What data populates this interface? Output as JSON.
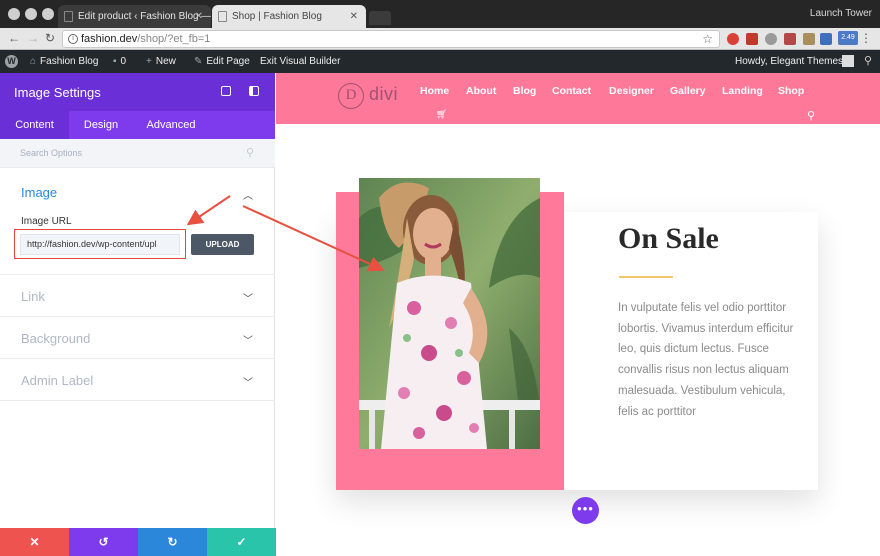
{
  "browser": {
    "tabs": [
      {
        "title": "Edit product ‹ Fashion Blog —"
      },
      {
        "title": "Shop | Fashion Blog"
      }
    ],
    "profile_name": "Launch Tower",
    "url": {
      "host": "fashion.dev",
      "path": "/shop/?et_fb=1"
    },
    "extension_badge": "2.49"
  },
  "wp_admin_bar": {
    "site_name": "Fashion Blog",
    "comments_count": "0",
    "new_label": "New",
    "edit_page_label": "Edit Page",
    "exit_builder_label": "Exit Visual Builder",
    "greeting": "Howdy, Elegant Themes"
  },
  "settings_panel": {
    "title": "Image Settings",
    "tabs": [
      {
        "label": "Content"
      },
      {
        "label": "Design"
      },
      {
        "label": "Advanced"
      }
    ],
    "search_placeholder": "Search Options",
    "sections": [
      {
        "title": "Image",
        "open": true
      },
      {
        "title": "Link"
      },
      {
        "title": "Background"
      },
      {
        "title": "Admin Label"
      }
    ],
    "image_url_label": "Image URL",
    "image_url_value": "http://fashion.dev/wp-content/upl",
    "upload_label": "UPLOAD",
    "colors": {
      "header": "#6b2fd8",
      "tabs": "#7e3bed",
      "cancel": "#ef5350",
      "undo": "#7e3bed",
      "redo": "#2b87da",
      "save": "#29c4a9"
    }
  },
  "site": {
    "logo_text": "divi",
    "logo_letter": "D",
    "nav": [
      "Home",
      "About",
      "Blog",
      "Contact",
      "Designer",
      "Gallery",
      "Landing",
      "Shop"
    ],
    "heading": "On Sale",
    "body": "In vulputate felis vel odio porttitor lobortis. Vivamus interdum efficitur leo, quis dictum lectus. Fusce convallis risus non lectus aliquam malesuada. Vestibulum vehicula, felis ac porttitor",
    "colors": {
      "header": "#fe7999",
      "accent": "#f2c66d"
    }
  }
}
